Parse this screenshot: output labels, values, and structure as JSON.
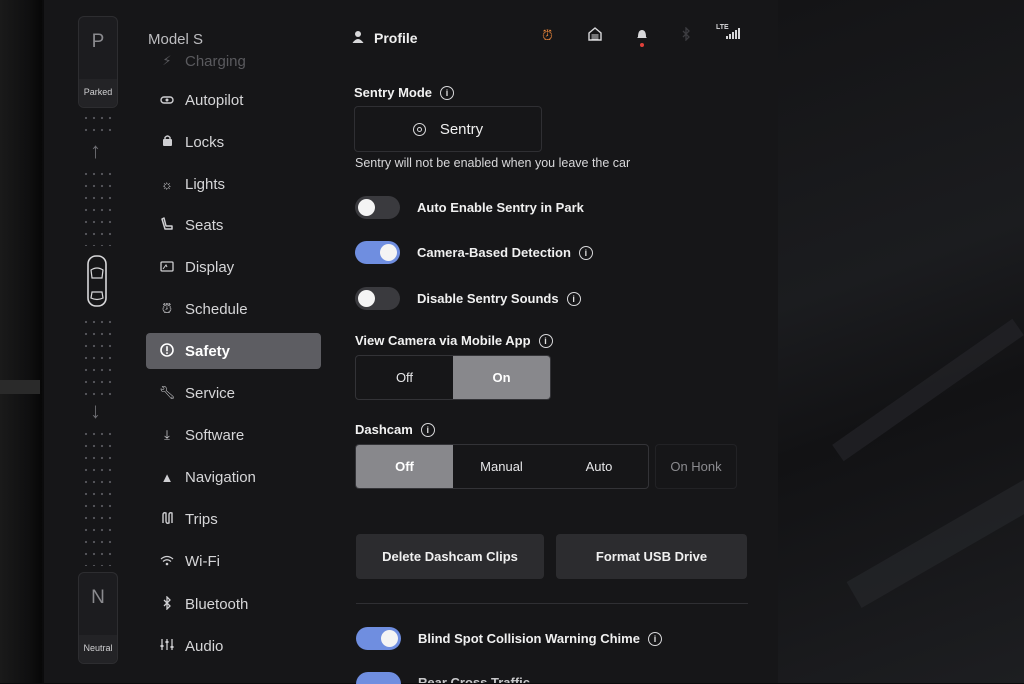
{
  "gear": {
    "top_letter": "P",
    "top_label": "Parked",
    "bottom_letter": "N",
    "bottom_label": "Neutral"
  },
  "sidebar": {
    "model": "Model S",
    "items": [
      {
        "label": "Charging",
        "icon": "bolt-icon"
      },
      {
        "label": "Autopilot",
        "icon": "steering-wheel-icon"
      },
      {
        "label": "Locks",
        "icon": "lock-icon"
      },
      {
        "label": "Lights",
        "icon": "sun-icon"
      },
      {
        "label": "Seats",
        "icon": "seat-icon"
      },
      {
        "label": "Display",
        "icon": "display-icon"
      },
      {
        "label": "Schedule",
        "icon": "alarm-clock-icon"
      },
      {
        "label": "Safety",
        "icon": "alert-circle-icon",
        "active": true
      },
      {
        "label": "Service",
        "icon": "wrench-icon"
      },
      {
        "label": "Software",
        "icon": "download-icon"
      },
      {
        "label": "Navigation",
        "icon": "navigation-arrow-icon"
      },
      {
        "label": "Trips",
        "icon": "trips-icon"
      },
      {
        "label": "Wi-Fi",
        "icon": "wifi-icon"
      },
      {
        "label": "Bluetooth",
        "icon": "bluetooth-icon"
      },
      {
        "label": "Audio",
        "icon": "equalizer-icon"
      }
    ]
  },
  "header": {
    "profile_label": "Profile",
    "lte_label": "LTE",
    "alarm_color": "#e8853a",
    "notification_dot_color": "#e0403a"
  },
  "sentry": {
    "title": "Sentry Mode",
    "button_label": "Sentry",
    "note": "Sentry will not be enabled when you leave the car"
  },
  "toggles": [
    {
      "label": "Auto Enable Sentry in Park",
      "on": false
    },
    {
      "label": "Camera-Based Detection",
      "on": true
    },
    {
      "label": "Disable Sentry Sounds",
      "on": false
    }
  ],
  "view_camera": {
    "title": "View Camera via Mobile App",
    "options": [
      "Off",
      "On"
    ],
    "selected": "On"
  },
  "dashcam": {
    "title": "Dashcam",
    "options": [
      "Off",
      "Manual",
      "Auto"
    ],
    "selected": "Off",
    "extra_option": "On Honk"
  },
  "buttons": {
    "delete_clips": "Delete Dashcam Clips",
    "format_usb": "Format USB Drive"
  },
  "blind_spot": {
    "label": "Blind Spot Collision Warning Chime",
    "on": true
  },
  "cut_off": {
    "label": "Rear Cross Traffic Chime",
    "on": true
  },
  "colors": {
    "toggle_on": "#6f8ee0",
    "selected_segment": "#88888c",
    "active_nav": "#5d5d62"
  }
}
